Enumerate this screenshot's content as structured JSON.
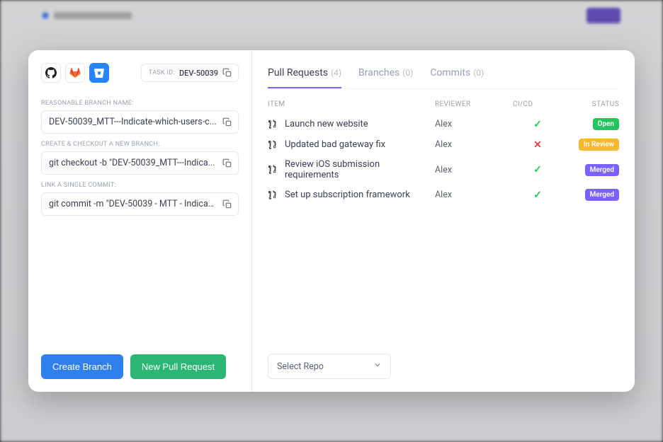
{
  "taskid_label": "TASK ID:",
  "taskid_value": "DEV-50039",
  "fields": {
    "branch_label": "REASONABLE BRANCH NAME:",
    "branch_value": "DEV-50039_MTT---Indicate-which-users-c...",
    "checkout_label": "CREATE & CHECKOUT A NEW BRANCH:",
    "checkout_value": "git checkout -b \"DEV-50039_MTT---Indica...",
    "commit_label": "LINK A SINGLE COMMIT:",
    "commit_value": "git commit -m \"DEV-50039 - MTT - Indicat..."
  },
  "buttons": {
    "create_branch": "Create Branch",
    "new_pr": "New Pull Request"
  },
  "tabs": {
    "pr_label": "Pull Requests",
    "pr_count": "(4)",
    "branches_label": "Branches",
    "branches_count": "(0)",
    "commits_label": "Commits",
    "commits_count": "(0)"
  },
  "columns": {
    "item": "ITEM",
    "reviewer": "REVIEWER",
    "cicd": "CI/CD",
    "status": "STATUS"
  },
  "rows": [
    {
      "item": "Launch new website",
      "reviewer": "Alex",
      "ci": "pass",
      "status": "Open",
      "badge": "open"
    },
    {
      "item": "Updated bad gateway fix",
      "reviewer": "Alex",
      "ci": "fail",
      "status": "In Review",
      "badge": "review"
    },
    {
      "item": "Review iOS submission requirements",
      "reviewer": "Alex",
      "ci": "pass",
      "status": "Merged",
      "badge": "merged"
    },
    {
      "item": "Set up subscription framework",
      "reviewer": "Alex",
      "ci": "pass",
      "status": "Merged",
      "badge": "merged"
    }
  ],
  "select_repo": "Select Repo"
}
